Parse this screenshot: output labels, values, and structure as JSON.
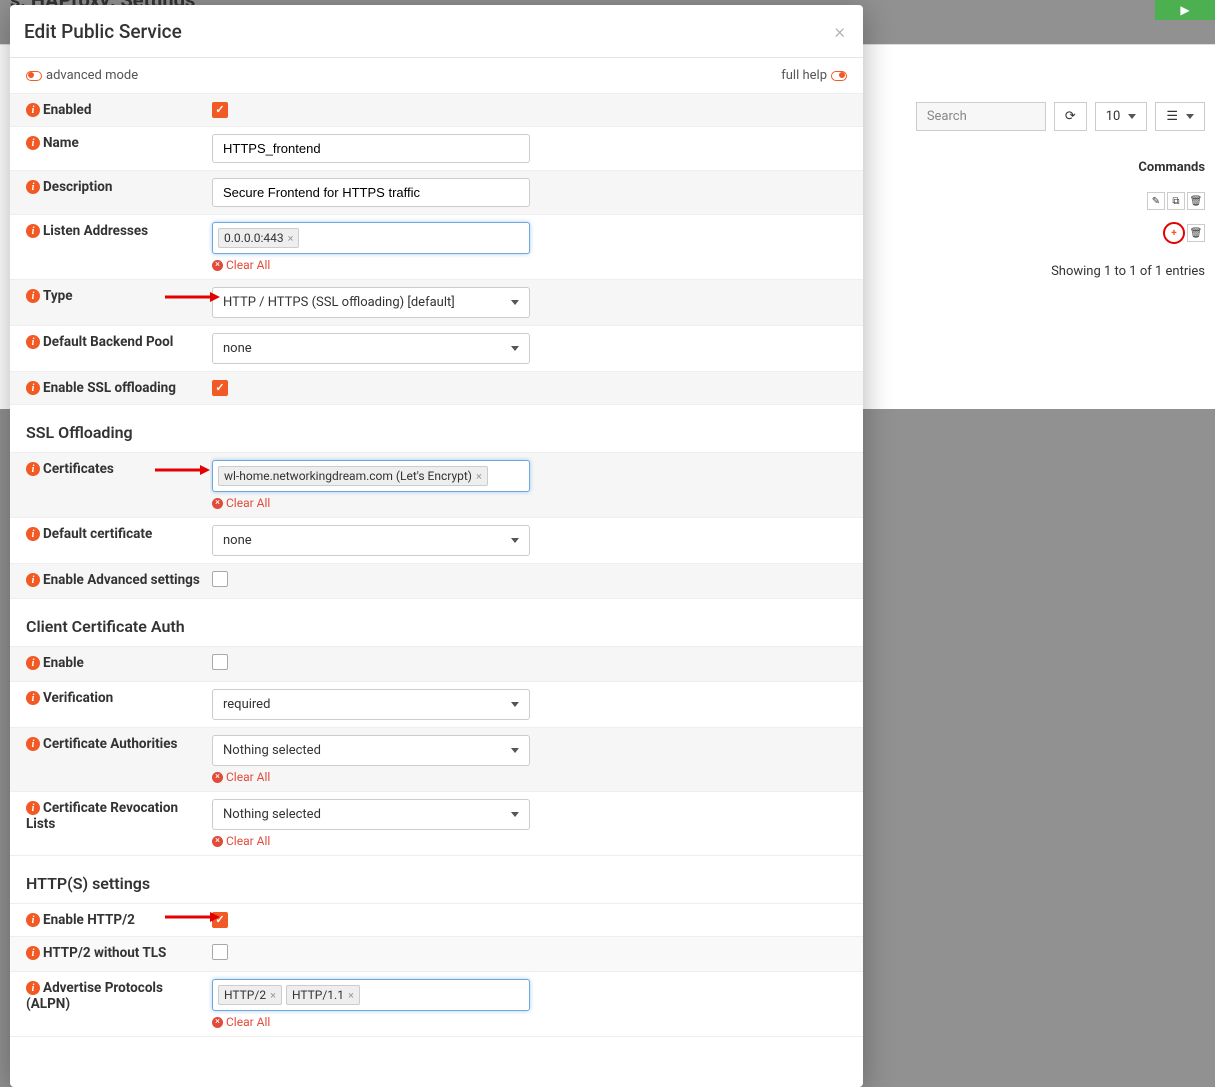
{
  "bg": {
    "title": "s: HAProxy: Settings",
    "play": "▶",
    "search_placeholder": "Search",
    "per_page": "10",
    "commands_label": "Commands",
    "showing": "Showing 1 to 1 of 1 entries"
  },
  "modal": {
    "title": "Edit Public Service",
    "advanced": "advanced mode",
    "fullhelp": "full help"
  },
  "labels": {
    "enabled": "Enabled",
    "name": "Name",
    "description": "Description",
    "listen": "Listen Addresses",
    "type": "Type",
    "backend": "Default Backend Pool",
    "sslofl": "Enable SSL offloading",
    "sslsection": "SSL Offloading",
    "certs": "Certificates",
    "defcert": "Default certificate",
    "enableadv": "Enable Advanced settings",
    "ccauth": "Client Certificate Auth",
    "enable": "Enable",
    "verification": "Verification",
    "cas": "Certificate Authorities",
    "crl": "Certificate Revocation Lists",
    "httpsection": "HTTP(S) settings",
    "http2": "Enable HTTP/2",
    "http2notls": "HTTP/2 without TLS",
    "alpn": "Advertise Protocols (ALPN)"
  },
  "values": {
    "name": "HTTPS_frontend",
    "description": "Secure Frontend for HTTPS traffic",
    "listen_token": "0.0.0.0:443",
    "type": "HTTP / HTTPS (SSL offloading) [default]",
    "backend": "none",
    "cert_token": "wl-home.networkingdream.com (Let's Encrypt)",
    "defcert": "none",
    "verification": "required",
    "nothing": "Nothing selected",
    "http2_token": "HTTP/2",
    "http11_token": "HTTP/1.1"
  },
  "actions": {
    "clear_all": "Clear All"
  }
}
